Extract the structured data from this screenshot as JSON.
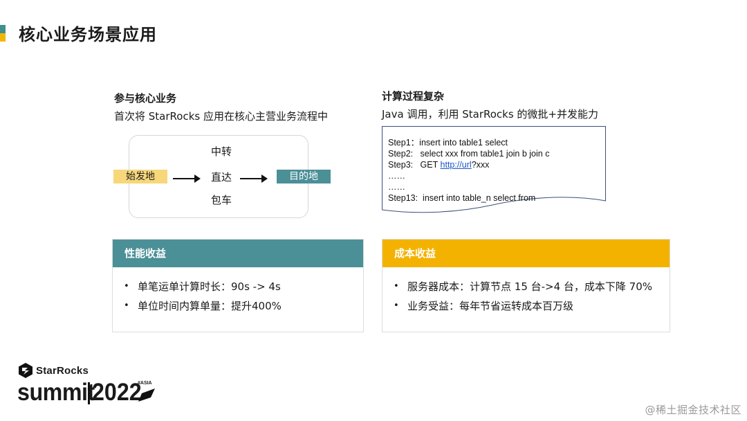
{
  "page": {
    "title": "核心业务场景应用",
    "accent_teal": "#3f8f8f",
    "accent_yellow": "#f2b705"
  },
  "left_section": {
    "heading": "参与核心业务",
    "subtitle": "首次将 StarRocks 应用在核心主营业务流程中",
    "flow": {
      "origin": "始发地",
      "modes": [
        "中转",
        "直达",
        "包车"
      ],
      "destination": "目的地"
    }
  },
  "right_section": {
    "heading": "计算过程复杂",
    "subtitle": "Java 调用，利用 StarRocks 的微批+并发能力",
    "code_lines": [
      {
        "text": "Step1：insert into table1 select"
      },
      {
        "text": "Step2:   select xxx from table1 join b join c"
      },
      {
        "prefix": "Step3:   GET ",
        "link": "http://url",
        "suffix": "?xxx"
      },
      {
        "text": "……"
      },
      {
        "text": "……"
      },
      {
        "text": "Step13:  insert into table_n select from"
      }
    ]
  },
  "cards": {
    "performance": {
      "title": "性能收益",
      "color": "#4b8f97",
      "items": [
        "单笔运单计算时长：90s -> 4s",
        "单位时间内算单量：提升400%"
      ]
    },
    "cost": {
      "title": "成本收益",
      "color": "#f4b200",
      "items": [
        "服务器成本：计算节点 15 台->4 台，成本下降 70%",
        "业务受益：每年节省运转成本百万级"
      ]
    }
  },
  "logo": {
    "brand": "StarRocks",
    "event": "summit",
    "year": "2022",
    "tag": "#ASIA"
  },
  "watermark": "@稀土掘金技术社区"
}
